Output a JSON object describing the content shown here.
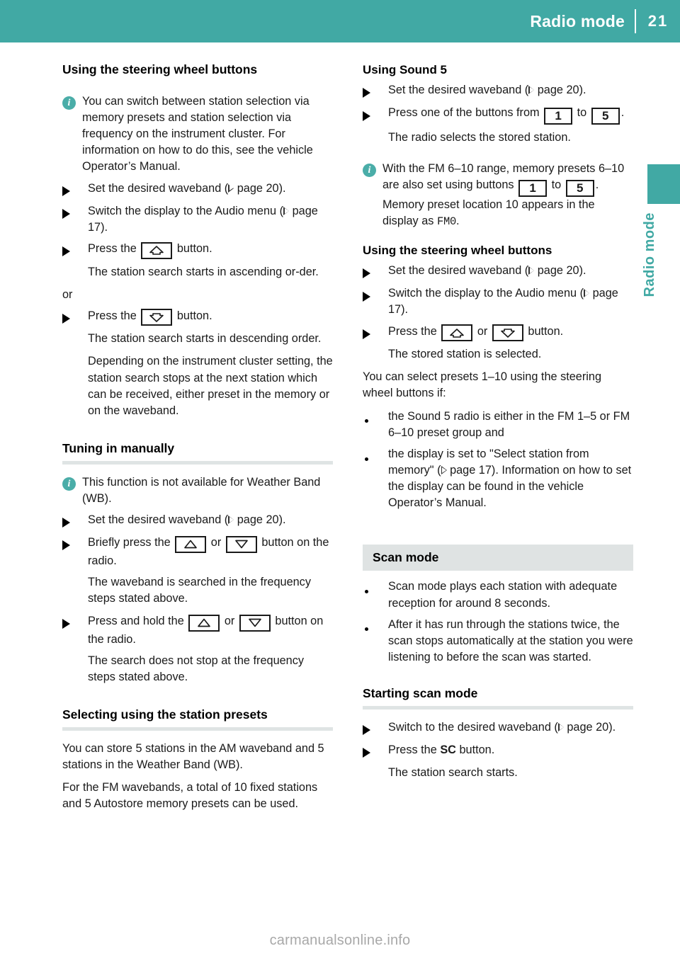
{
  "header": {
    "title": "Radio mode",
    "page_number": "21",
    "bg_color": "#41a9a4",
    "text_color": "#ffffff"
  },
  "side_tab": {
    "label": "Radio mode",
    "color": "#41a9a4"
  },
  "left_column": {
    "heading_1": "Using the steering wheel buttons",
    "info_1": "You can switch between station selection via memory presets and station selection via frequency on the instrument cluster. For information on how to do this, see the vehicle Operator’s Manual.",
    "step_1": "Set the desired waveband (",
    "step_1_ref": "page 20).",
    "step_2": "Switch the display to the Audio menu (",
    "step_2_ref": "page 17).",
    "step_3_pre": "Press the",
    "step_3_post": "button.",
    "result_1_line": "The station search starts in ascending or-der.",
    "or_label": "or",
    "step_4_pre": "Press the",
    "step_4_post": "button.",
    "result_2_line": "The station search starts in descending order.",
    "note_1": "Depending on the instrument cluster setting, the station search stops at the next station which can be received, either preset in the memory or on the waveband.",
    "heading_2": "Tuning in manually",
    "info_2": "This function is not available for Weather Band (WB).",
    "step_5": "Set the desired waveband (",
    "step_5_ref": "page 20).",
    "step_6_pre": "Briefly press the",
    "step_6_mid": "or",
    "step_6_post": "button on the radio.",
    "result_3": "The waveband is searched in the frequency steps stated above.",
    "step_7_pre": "Press and hold the",
    "step_7_mid": "or",
    "step_7_post": "button on the radio.",
    "result_4": "The search does not stop at the frequency steps stated above.",
    "heading_3": "Selecting using the station presets",
    "para_1": "You can store 5 stations in the AM waveband and 5 stations in the Weather Band (WB).",
    "para_2": "For the FM wavebands, a total of 10 fixed stations and 5 Autostore memory presets can be used."
  },
  "right_column": {
    "heading_1": "Using Sound 5",
    "step_1": "Set the desired waveband (",
    "step_1_ref": "page 20).",
    "step_2_pre": "Press one of the buttons from",
    "step_2_mid": "to",
    "step_2_post": ".",
    "result_1": "The radio selects the stored station.",
    "info_1_pre": "With the FM 6–10 range, memory presets 6–10 are also set using buttons",
    "info_1_mid": "to",
    "info_1_post": ". Memory preset location 10 appears in the display as",
    "info_1_display_value": "FM0",
    "info_1_end": ".",
    "heading_2": "Using the steering wheel buttons",
    "step_3": "Set the desired waveband (",
    "step_3_ref": "page 20).",
    "step_4": "Switch the display to the Audio menu (",
    "step_4_ref": "page 17).",
    "step_5_pre": "Press the",
    "step_5_mid": "or",
    "step_5_post": "button.",
    "result_2": "The stored station is selected.",
    "para_1": "You can select presets 1–10 using the steering wheel buttons if:",
    "bullet_1": "the Sound 5 radio is either in the FM 1–5 or FM 6–10 preset group and",
    "bullet_2_pre": "the display is set to \"Select station from memory\" (",
    "bullet_2_post": "page 17). Information on how to set the display can be found in the vehicle Operator’s Manual.",
    "band_heading": "Scan mode",
    "scan_bullet_1": "Scan mode plays each station with adequate reception for around 8 seconds.",
    "scan_bullet_2": "After it has run through the stations twice, the scan stops automatically at the station you were listening to before the scan was started.",
    "heading_3": "Starting scan mode",
    "step_6": "Switch to the desired waveband (",
    "step_6_ref": "page 20).",
    "step_7_pre": "Press the",
    "step_7_key": "SC",
    "step_7_post": "button.",
    "result_3": "The station search starts."
  },
  "keys": {
    "sw_up": "steering-wheel-up-button",
    "sw_down": "steering-wheel-down-button",
    "radio_up": "radio-up-button",
    "radio_down": "radio-down-button",
    "preset_1": "1",
    "preset_5": "5"
  },
  "footer": {
    "watermark": "carmanualsonline.info"
  }
}
